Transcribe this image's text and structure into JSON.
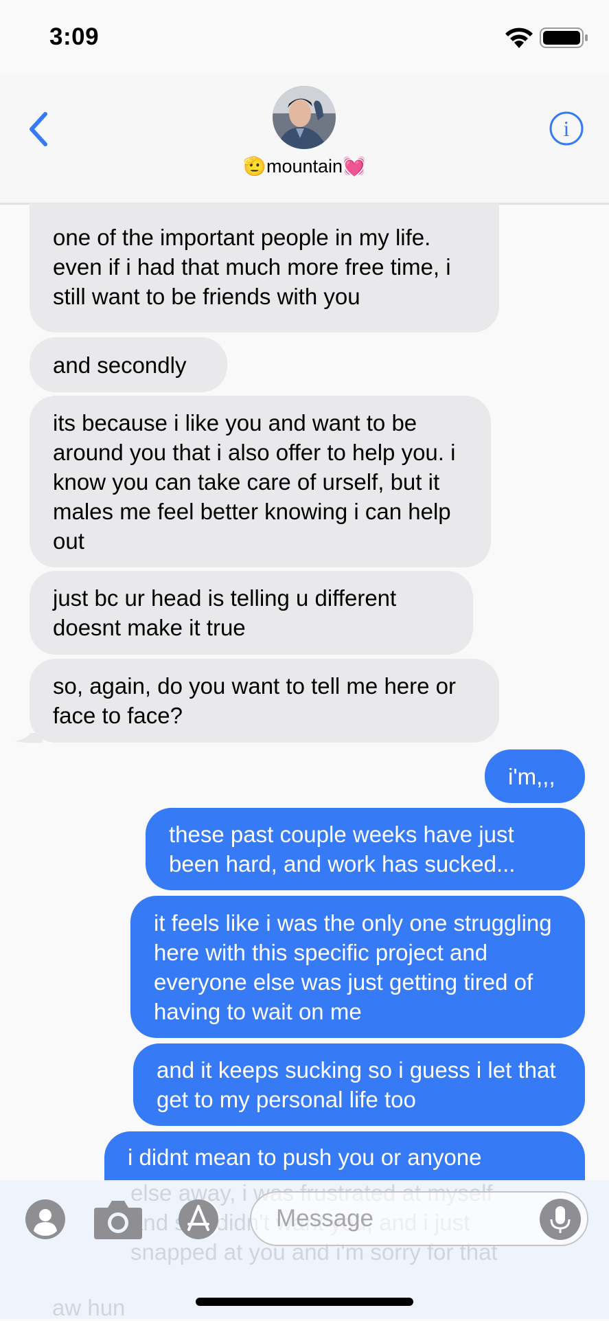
{
  "status": {
    "time": "3:09",
    "wifi_icon": "wifi-icon",
    "battery_icon": "battery-icon"
  },
  "header": {
    "contact_name": "🫡mountain💓",
    "back_icon": "chevron-left-icon",
    "info_icon": "info-icon",
    "accent": "#367af5"
  },
  "messages": [
    {
      "from": "them",
      "text": "one of the important people in my life. even if i had that much more free time, i still want to be friends with you"
    },
    {
      "from": "them",
      "text": "and secondly"
    },
    {
      "from": "them",
      "text": "its because i like you and want to be around you that i also offer to help you. i know you can take care of urself, but it males me feel better knowing i can help out"
    },
    {
      "from": "them",
      "text": "just bc ur head is telling u different doesnt make it true"
    },
    {
      "from": "them",
      "text": "so, again, do you want to tell me here or face to face?"
    },
    {
      "from": "me",
      "text": "i'm,,,"
    },
    {
      "from": "me",
      "text": "these past couple weeks have just been hard, and work has sucked..."
    },
    {
      "from": "me",
      "text": "it feels like i was the only one struggling here with this specific project and everyone else was just getting tired of having to wait on me"
    },
    {
      "from": "me",
      "text": "and it keeps sucking so i guess i let that get to my personal life too"
    },
    {
      "from": "me",
      "text": "i didnt mean to push you or anyone"
    }
  ],
  "composer": {
    "placeholder": "Message",
    "ghost_lines": [
      "else away, i was frustrated at myself",
      "and so i didn't want you, and i just",
      "snapped at you and i'm sorry for that",
      "aw hun"
    ]
  },
  "colors": {
    "incoming_bubble": "#e9e9eb",
    "outgoing_bubble": "#367af5"
  }
}
